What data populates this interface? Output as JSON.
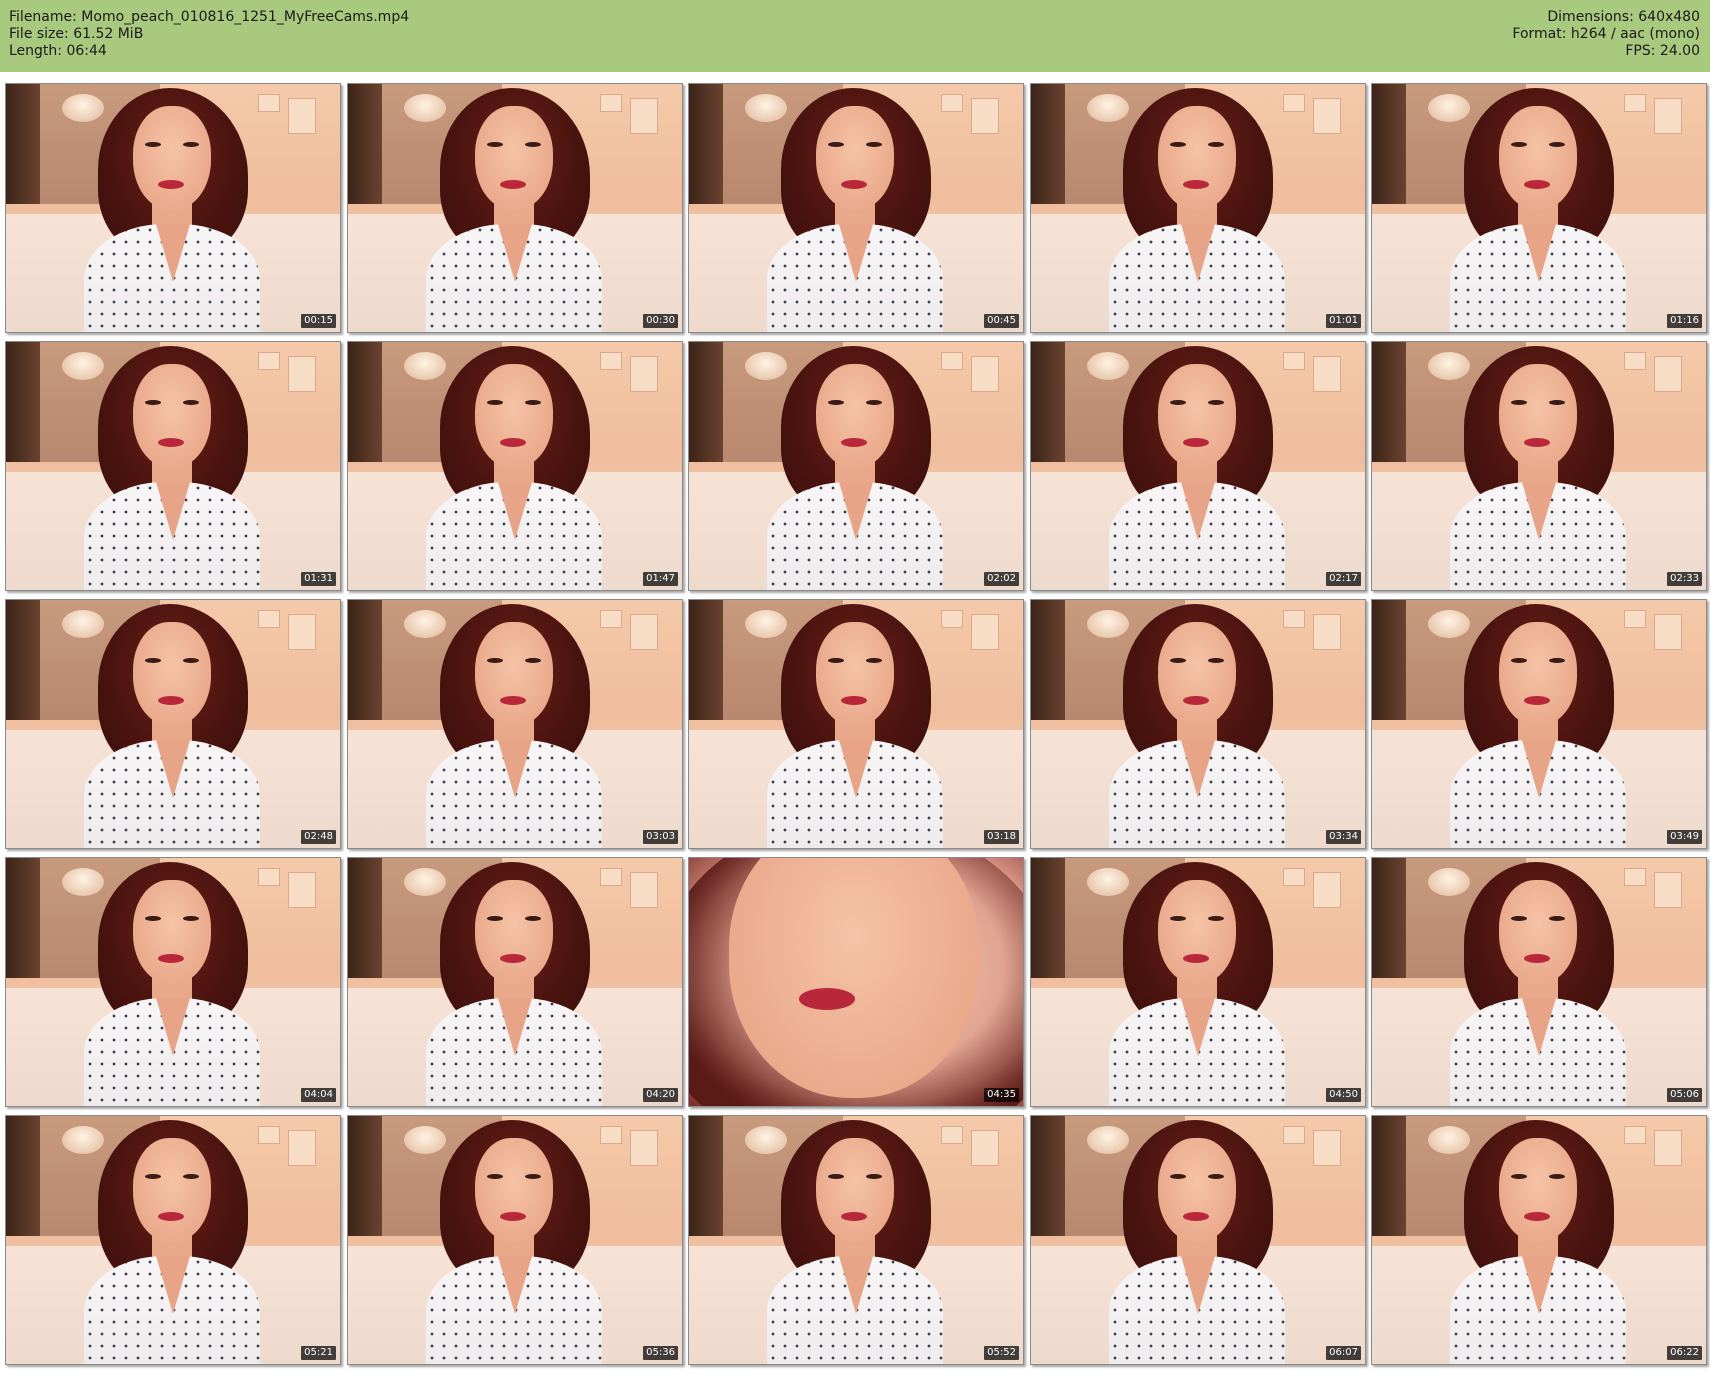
{
  "header": {
    "filename": "Filename: Momo_peach_010816_1251_MyFreeCams.mp4",
    "filesize": "File size: 61.52 MiB",
    "length": "Length: 06:44",
    "dimensions": "Dimensions: 640x480",
    "format": "Format: h264 / aac (mono)",
    "fps": "FPS: 24.00"
  },
  "frames": [
    {
      "timestamp": "00:15"
    },
    {
      "timestamp": "00:30"
    },
    {
      "timestamp": "00:45"
    },
    {
      "timestamp": "01:01"
    },
    {
      "timestamp": "01:16"
    },
    {
      "timestamp": "01:31"
    },
    {
      "timestamp": "01:47"
    },
    {
      "timestamp": "02:02"
    },
    {
      "timestamp": "02:17"
    },
    {
      "timestamp": "02:33"
    },
    {
      "timestamp": "02:48"
    },
    {
      "timestamp": "03:03"
    },
    {
      "timestamp": "03:18"
    },
    {
      "timestamp": "03:34"
    },
    {
      "timestamp": "03:49"
    },
    {
      "timestamp": "04:04"
    },
    {
      "timestamp": "04:20"
    },
    {
      "timestamp": "04:35",
      "closeup": true
    },
    {
      "timestamp": "04:50"
    },
    {
      "timestamp": "05:06"
    },
    {
      "timestamp": "05:21"
    },
    {
      "timestamp": "05:36"
    },
    {
      "timestamp": "05:52"
    },
    {
      "timestamp": "06:07"
    },
    {
      "timestamp": "06:22"
    }
  ],
  "colors": {
    "header_background": "#a9c97f",
    "timestamp_background": "#000000",
    "timestamp_text": "#ffffff"
  }
}
